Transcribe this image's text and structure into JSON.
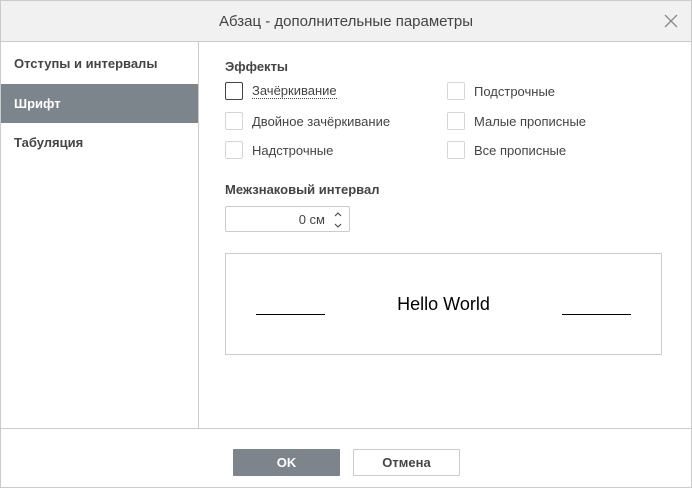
{
  "window": {
    "title": "Абзац - дополнительные параметры"
  },
  "sidebar": {
    "items": [
      {
        "label": "Отступы и интервалы",
        "active": false
      },
      {
        "label": "Шрифт",
        "active": true
      },
      {
        "label": "Табуляция",
        "active": false
      }
    ]
  },
  "effects": {
    "title": "Эффекты",
    "left": [
      {
        "label": "Зачёркивание",
        "checked": false
      },
      {
        "label": "Двойное зачёркивание",
        "checked": false
      },
      {
        "label": "Надстрочные",
        "checked": false
      }
    ],
    "right": [
      {
        "label": "Подстрочные",
        "checked": false
      },
      {
        "label": "Малые прописные",
        "checked": false
      },
      {
        "label": "Все прописные",
        "checked": false
      }
    ]
  },
  "spacing": {
    "title": "Межзнаковый интервал",
    "value": "0 см"
  },
  "preview": {
    "text": "Hello World"
  },
  "footer": {
    "ok_label": "OK",
    "cancel_label": "Отмена"
  },
  "colors": {
    "accent": "#7d858c",
    "border": "#cbcbcb",
    "text": "#444444",
    "titlebar": "#f1f1f1"
  },
  "icons": {
    "close": "close-icon",
    "spin_up": "chevron-up-icon",
    "spin_down": "chevron-down-icon"
  }
}
